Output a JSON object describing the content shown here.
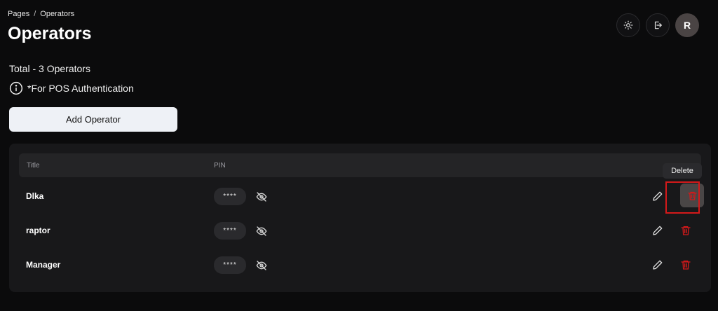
{
  "breadcrumb": {
    "root": "Pages",
    "separator": "/",
    "current": "Operators"
  },
  "page": {
    "title": "Operators",
    "total_text": "Total - 3 Operators",
    "note_text": "*For POS Authentication",
    "add_button_label": "Add Operator"
  },
  "header": {
    "avatar_initial": "R",
    "icons": [
      "sun-icon",
      "logout-icon"
    ]
  },
  "table": {
    "columns": {
      "title": "Title",
      "pin": "PIN"
    },
    "rows": [
      {
        "name": "Dlka",
        "pin_masked": "****"
      },
      {
        "name": "raptor",
        "pin_masked": "****"
      },
      {
        "name": "Manager",
        "pin_masked": "****"
      }
    ]
  },
  "tooltip": {
    "text": "Delete"
  },
  "colors": {
    "background": "#0b0b0c",
    "card": "#18181a",
    "danger": "#d4191a",
    "primary_button": "#eef1f6"
  }
}
